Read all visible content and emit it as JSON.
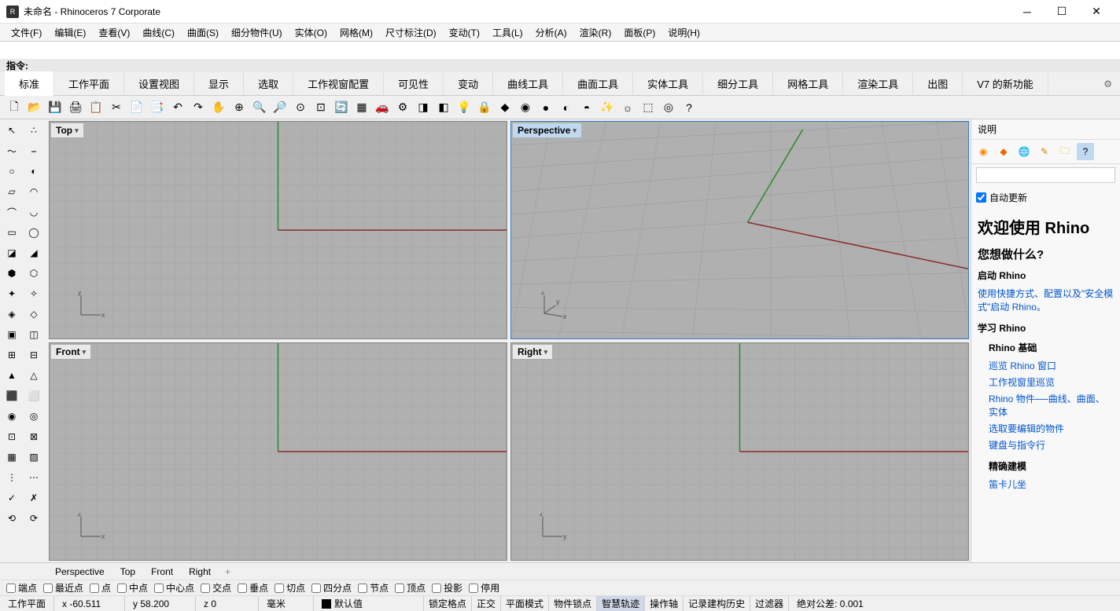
{
  "app": {
    "title": "未命名 - Rhinoceros 7 Corporate"
  },
  "menubar": [
    "文件(F)",
    "编辑(E)",
    "查看(V)",
    "曲线(C)",
    "曲面(S)",
    "细分物件(U)",
    "实体(O)",
    "网格(M)",
    "尺寸标注(D)",
    "变动(T)",
    "工具(L)",
    "分析(A)",
    "渲染(R)",
    "面板(P)",
    "说明(H)"
  ],
  "cmd": {
    "label": "指令:"
  },
  "tabs": [
    "标准",
    "工作平面",
    "设置视图",
    "显示",
    "选取",
    "工作视窗配置",
    "可见性",
    "变动",
    "曲线工具",
    "曲面工具",
    "实体工具",
    "细分工具",
    "网格工具",
    "渲染工具",
    "出图",
    "V7 的新功能"
  ],
  "viewports": {
    "top": "Top",
    "perspective": "Perspective",
    "front": "Front",
    "right": "Right"
  },
  "panel": {
    "header": "说明",
    "auto_update": "自动更新",
    "welcome": "欢迎使用 Rhino",
    "q": "您想做什么?",
    "start": "启动 Rhino",
    "start_link": "使用快捷方式、配置以及\"安全模式\"启动 Rhino。",
    "learn": "学习 Rhino",
    "basics": "Rhino 基础",
    "links": [
      "巡览 Rhino 窗口",
      "工作视窗里巡览",
      "Rhino 物件──曲线、曲面、实体",
      "选取要编辑的物件",
      "键盘与指令行"
    ],
    "precise": "精确建模",
    "cartesian": "笛卡儿坐"
  },
  "bottom_tabs": [
    "Perspective",
    "Top",
    "Front",
    "Right"
  ],
  "osnap": [
    "端点",
    "最近点",
    "点",
    "中点",
    "中心点",
    "交点",
    "垂点",
    "切点",
    "四分点",
    "节点",
    "顶点",
    "投影",
    "停用"
  ],
  "status": {
    "cplane": "工作平面",
    "x": "x -60.511",
    "y": "y 58.200",
    "z": "z 0",
    "unit": "毫米",
    "layer": "默认值",
    "segs": [
      "锁定格点",
      "正交",
      "平面模式",
      "物件锁点",
      "智慧轨迹",
      "操作轴",
      "记录建构历史",
      "过滤器"
    ],
    "tol": "绝对公差: 0.001"
  }
}
